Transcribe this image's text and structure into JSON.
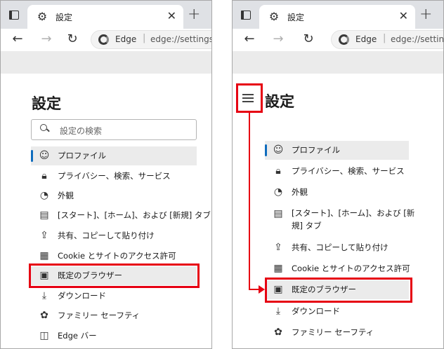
{
  "tab": {
    "title": "設定"
  },
  "address": {
    "site": "Edge",
    "separator": "|",
    "url_left": "edge://settings/",
    "url_right": "edge://settin"
  },
  "settings_title": "設定",
  "search": {
    "placeholder": "設定の検索"
  },
  "nav_left": [
    {
      "label": "プロファイル",
      "icon": "profile-icon",
      "selected": true
    },
    {
      "label": "プライバシー、検索、サービス",
      "icon": "lock-icon"
    },
    {
      "label": "外観",
      "icon": "palette-icon"
    },
    {
      "label": "[スタート]、[ホーム]、および [新規] タブ",
      "icon": "start-page-icon"
    },
    {
      "label": "共有、コピーして貼り付け",
      "icon": "share-icon"
    },
    {
      "label": "Cookie とサイトのアクセス許可",
      "icon": "site-permissions-icon"
    },
    {
      "label": "既定のブラウザー",
      "icon": "default-browser-icon",
      "highlighted": true
    },
    {
      "label": "ダウンロード",
      "icon": "download-icon"
    },
    {
      "label": "ファミリー セーフティ",
      "icon": "family-icon"
    },
    {
      "label": "Edge バー",
      "icon": "edge-bar-icon"
    }
  ],
  "nav_right": [
    {
      "label": "プロファイル",
      "icon": "profile-icon",
      "selected": true
    },
    {
      "label": "プライバシー、検索、サービス",
      "icon": "lock-icon"
    },
    {
      "label": "外観",
      "icon": "palette-icon"
    },
    {
      "label": "[スタート]、[ホーム]、および [新",
      "label2": "規] タブ",
      "icon": "start-page-icon"
    },
    {
      "label": "共有、コピーして貼り付け",
      "icon": "share-icon"
    },
    {
      "label": "Cookie とサイトのアクセス許可",
      "icon": "site-permissions-icon"
    },
    {
      "label": "既定のブラウザー",
      "icon": "default-browser-icon",
      "highlighted": true
    },
    {
      "label": "ダウンロード",
      "icon": "download-icon"
    },
    {
      "label": "ファミリー セーフティ",
      "icon": "family-icon"
    }
  ],
  "colors": {
    "accent": "#0f6cbd",
    "highlight": "#e60012",
    "selected_bg": "#ebebeb"
  }
}
